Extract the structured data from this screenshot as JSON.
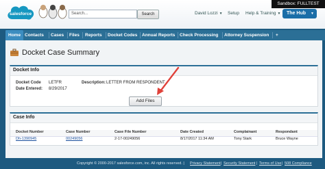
{
  "header": {
    "logo_text": "salesforce",
    "search": {
      "placeholder": "Search...",
      "button": "Search"
    },
    "sandbox": "Sandbox: FULLTEST",
    "user": "David Lozzi",
    "setup": "Setup",
    "help": "Help & Training",
    "app": "The Hub"
  },
  "nav": {
    "tabs": [
      "Home",
      "Contacts",
      "Cases",
      "Files",
      "Reports",
      "Docket Codes",
      "Annual Reports",
      "Check Processing",
      "Attorney Suspension"
    ],
    "add": "+"
  },
  "page": {
    "title": "Docket Case Summary"
  },
  "docket_info": {
    "heading": "Docket Info",
    "code_label": "Docket Code",
    "code_value": "LETFR",
    "description_label": "Description:",
    "description_value": "LETTER FROM RESPONDENT",
    "date_label": "Date Entered:",
    "date_value": "8/29/2017",
    "add_files": "Add Files"
  },
  "case_info": {
    "heading": "Case Info",
    "columns": [
      "Docket Number",
      "Case Number",
      "Case File Number",
      "Date Created",
      "Complainant",
      "Respondant"
    ],
    "rows": [
      [
        "Dh-1390945",
        "00249056",
        "2-17-00249056",
        "8/17/2017 11:34 AM",
        "Tony Stark",
        "Bruce Wayne"
      ]
    ]
  },
  "footer": {
    "copyright": "Copyright © 2000-2017 salesforce.com, inc. All rights reserved. |",
    "links": [
      "Privacy Statement",
      "Security Statement",
      "Terms of Use",
      "508 Compliance"
    ]
  },
  "colors": {
    "nav": "#2b6f96",
    "accent": "#1b6ea8",
    "annotation": "#e0413a"
  }
}
